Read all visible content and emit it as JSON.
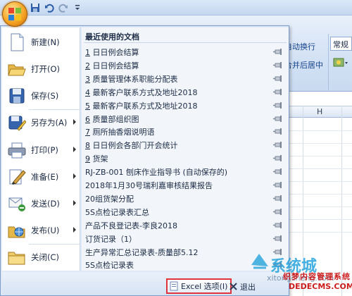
{
  "ribbon": {
    "wrap_text": "自动换行",
    "merge_center": "合并后居中",
    "number_format": "常规",
    "column_h": "H"
  },
  "menu": {
    "items": [
      {
        "label": "新建(N)",
        "icon": "new-document-icon",
        "has_arrow": false
      },
      {
        "label": "打开(O)",
        "icon": "open-folder-icon",
        "has_arrow": false
      },
      {
        "label": "保存(S)",
        "icon": "save-disk-icon",
        "has_arrow": false
      },
      {
        "label": "另存为(A)",
        "icon": "save-as-icon",
        "has_arrow": true
      },
      {
        "label": "打印(P)",
        "icon": "printer-icon",
        "has_arrow": true
      },
      {
        "label": "准备(E)",
        "icon": "prepare-icon",
        "has_arrow": true
      },
      {
        "label": "发送(D)",
        "icon": "send-icon",
        "has_arrow": true
      },
      {
        "label": "发布(U)",
        "icon": "publish-icon",
        "has_arrow": true
      },
      {
        "label": "关闭(C)",
        "icon": "close-folder-icon",
        "has_arrow": false
      }
    ],
    "recent_title": "最近使用的文档",
    "recent": [
      {
        "num": "1",
        "name": "日日例会结算"
      },
      {
        "num": "2",
        "name": "日日例会结算"
      },
      {
        "num": "3",
        "name": "质量管理体系职能分配表"
      },
      {
        "num": "4",
        "name": "最新客户联系方式及地址2018"
      },
      {
        "num": "5",
        "name": "最新客户联系方式及地址2018"
      },
      {
        "num": "6",
        "name": "质量部组织图"
      },
      {
        "num": "7",
        "name": "厕所抽香烟说明语"
      },
      {
        "num": "8",
        "name": "日日例会各部门开会统计"
      },
      {
        "num": "9",
        "name": "货架"
      },
      {
        "num": "",
        "name": "RJ-ZB-001 刨床作业指导书 (自动保存的)"
      },
      {
        "num": "",
        "name": "2018年1月30号瑞利嘉审核结果报告"
      },
      {
        "num": "",
        "name": "20组货架分配"
      },
      {
        "num": "",
        "name": "5S点检记录表汇总"
      },
      {
        "num": "",
        "name": "产品不良登记表-李良2018"
      },
      {
        "num": "",
        "name": "订货记录（1）"
      },
      {
        "num": "",
        "name": "生产异常汇总记录表-质量部5.12"
      },
      {
        "num": "",
        "name": "5S点检记录表"
      }
    ],
    "options_button": "Excel 选项(I)",
    "exit_button": "退出"
  },
  "watermark": {
    "cn": "系统城",
    "url": "xitongcheng.com",
    "brand": "织梦内容管理系统",
    "site": "DEDECMS.COM"
  },
  "colors": {
    "accent": "#1b2a45",
    "highlight_border": "#e0343c",
    "menu_bg": "#dfe8f5",
    "ribbon_bg": "#d2e1f4"
  }
}
